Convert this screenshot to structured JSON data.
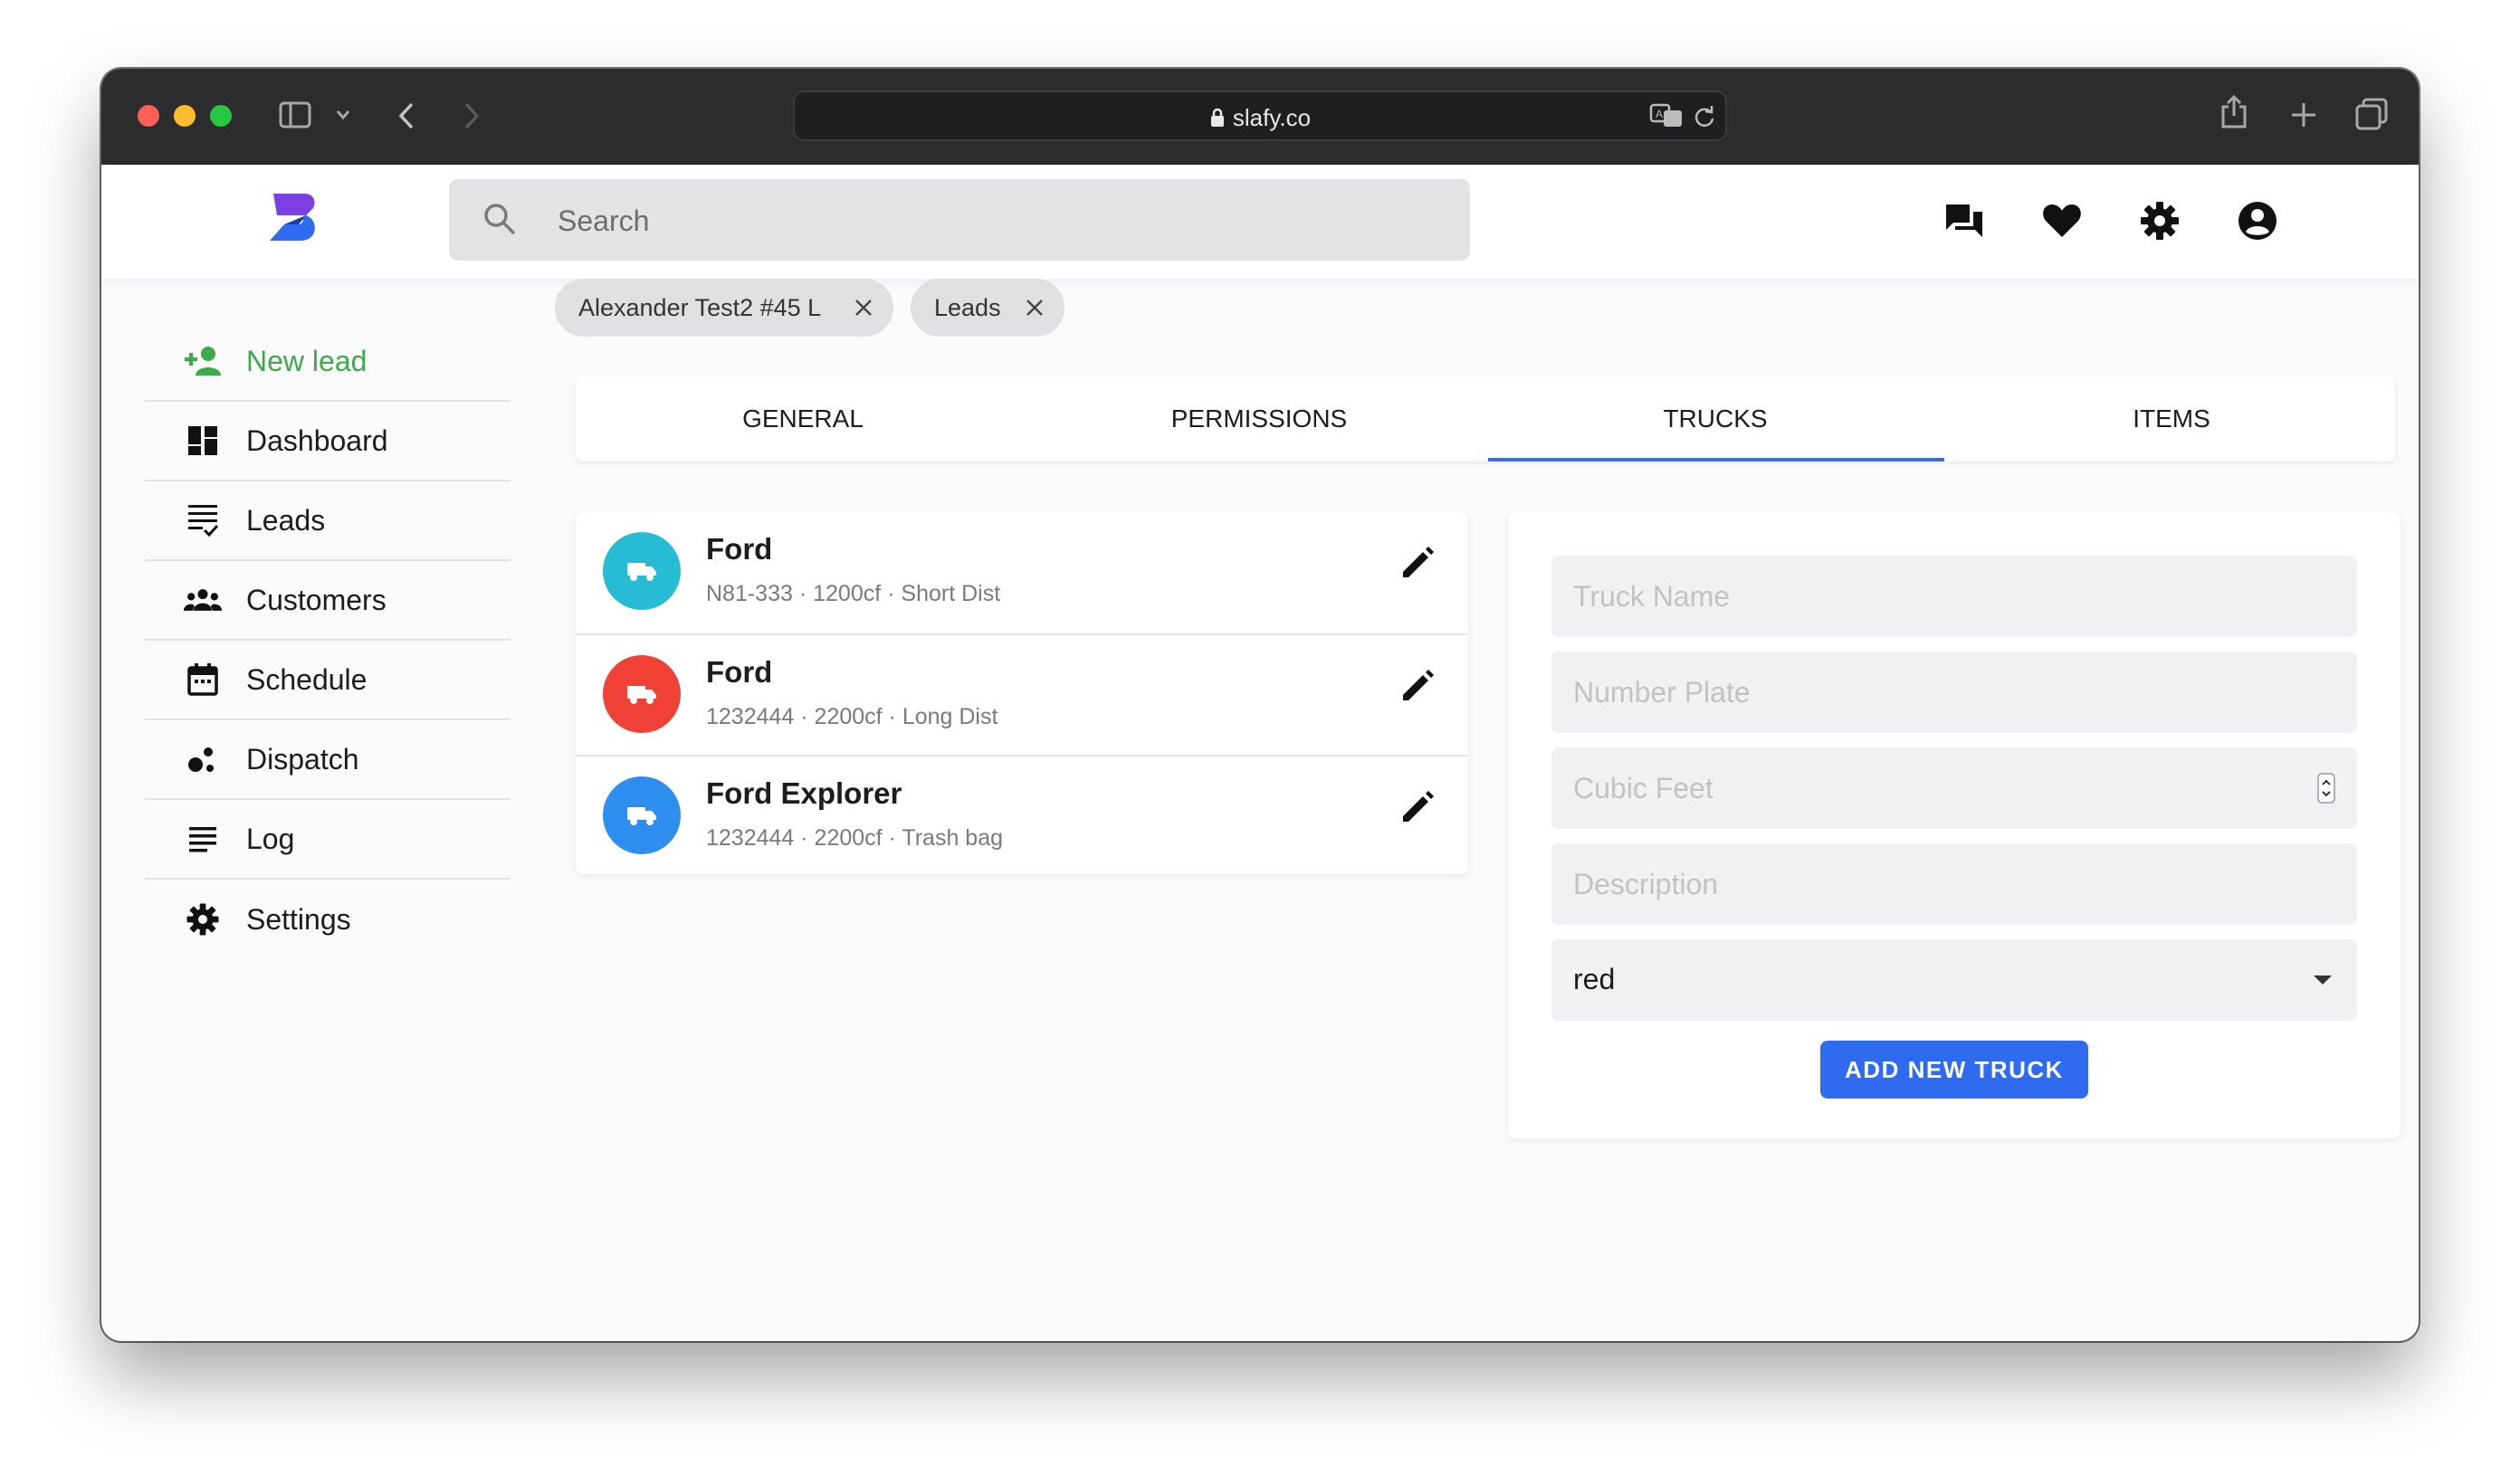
{
  "browser": {
    "url": "slafy.co"
  },
  "header": {
    "search_placeholder": "Search",
    "icons": [
      "chat-icon",
      "heart-icon",
      "gear-icon",
      "account-icon"
    ]
  },
  "breadcrumbs": [
    {
      "label": "Alexander Test2 #45 L"
    },
    {
      "label": "Leads"
    }
  ],
  "sidebar": {
    "items": [
      {
        "label": "New lead",
        "icon": "person-add-icon",
        "color": "#3bab4a"
      },
      {
        "label": "Dashboard",
        "icon": "dashboard-icon"
      },
      {
        "label": "Leads",
        "icon": "list-check-icon"
      },
      {
        "label": "Customers",
        "icon": "people-icon"
      },
      {
        "label": "Schedule",
        "icon": "calendar-icon"
      },
      {
        "label": "Dispatch",
        "icon": "bubble-chart-icon"
      },
      {
        "label": "Log",
        "icon": "lines-icon"
      },
      {
        "label": "Settings",
        "icon": "gear-icon"
      }
    ]
  },
  "tabs": [
    {
      "label": "GENERAL"
    },
    {
      "label": "PERMISSIONS"
    },
    {
      "label": "TRUCKS",
      "active": true
    },
    {
      "label": "ITEMS"
    }
  ],
  "trucks": [
    {
      "name": "Ford",
      "meta": "N81-333 · 1200cf · Short Dist",
      "color": "#26bcd4"
    },
    {
      "name": "Ford",
      "meta": "1232444 · 2200cf · Long Dist",
      "color": "#ef4136"
    },
    {
      "name": "Ford Explorer",
      "meta": "1232444 · 2200cf · Trash bag",
      "color": "#2d8ef0"
    }
  ],
  "form": {
    "truck_name_placeholder": "Truck Name",
    "number_plate_placeholder": "Number Plate",
    "cubic_feet_placeholder": "Cubic Feet",
    "description_placeholder": "Description",
    "color_value": "red",
    "submit_label": "ADD NEW TRUCK"
  }
}
